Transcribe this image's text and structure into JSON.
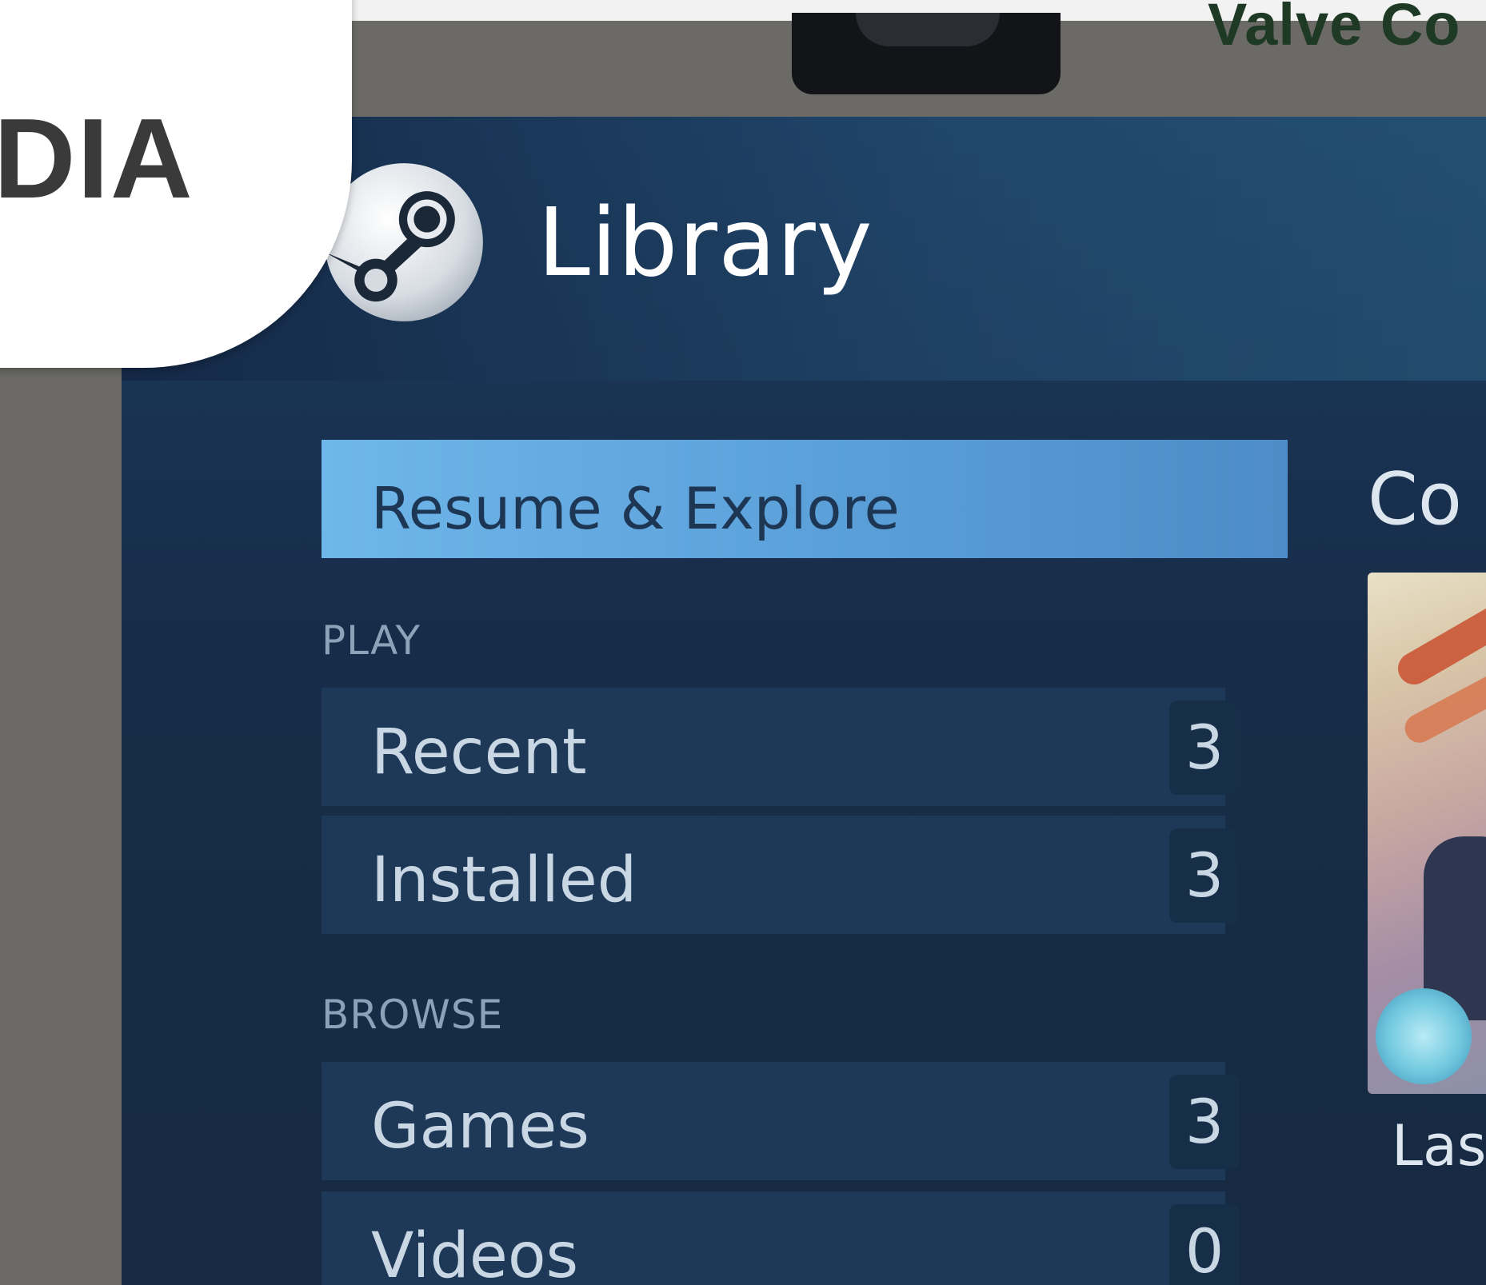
{
  "device": {
    "notification_text": "Valve Co",
    "logo_text": "DIA"
  },
  "header": {
    "title": "Library",
    "icon": "steam-logo-icon"
  },
  "sidebar": {
    "selected": {
      "label": "Resume & Explore"
    },
    "sections": [
      {
        "header": "PLAY",
        "items": [
          {
            "label": "Recent",
            "count": "3"
          },
          {
            "label": "Installed",
            "count": "3"
          }
        ]
      },
      {
        "header": "BROWSE",
        "items": [
          {
            "label": "Games",
            "count": "3"
          },
          {
            "label": "Videos",
            "count": "0"
          }
        ]
      }
    ]
  },
  "content": {
    "heading": "Co",
    "game_title": "Las"
  },
  "colors": {
    "selected_bg": "#5a9fd8",
    "screen_bg": "#172c48",
    "row_bg": "#1e3858"
  }
}
